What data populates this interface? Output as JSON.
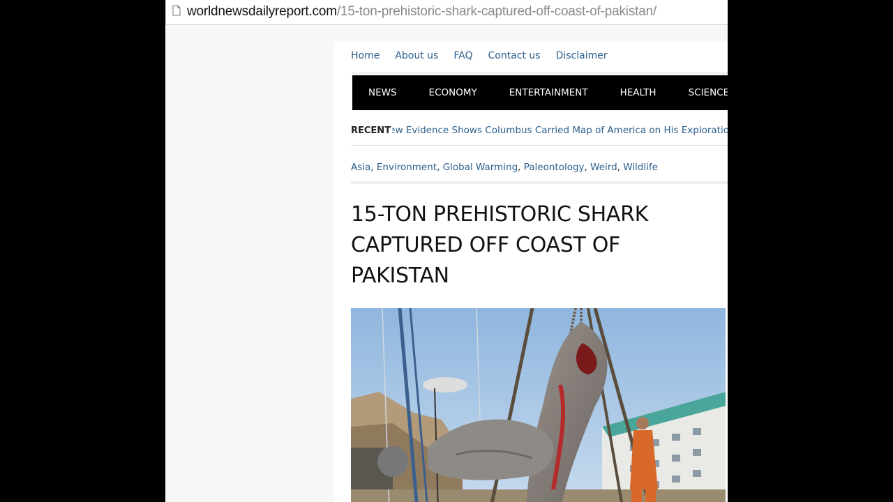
{
  "browser": {
    "url_domain": "worldnewsdailyreport.com",
    "url_path": "/15-ton-prehistoric-shark-captured-off-coast-of-pakistan/"
  },
  "top_nav": {
    "items": [
      {
        "label": "Home"
      },
      {
        "label": "About us"
      },
      {
        "label": "FAQ"
      },
      {
        "label": "Contact us"
      },
      {
        "label": "Disclaimer"
      }
    ]
  },
  "category_nav": {
    "items": [
      {
        "label": "NEWS"
      },
      {
        "label": "ECONOMY"
      },
      {
        "label": "ENTERTAINMENT"
      },
      {
        "label": "HEALTH"
      },
      {
        "label": "SCIENCE"
      }
    ]
  },
  "recent": {
    "label": "RECENT",
    "headline": "New Evidence Shows Columbus Carried Map of America on His Exploration"
  },
  "tags": [
    "Asia",
    "Environment",
    "Global Warming",
    "Paleontology",
    "Weird",
    "Wildlife"
  ],
  "tag_separator": ",",
  "article": {
    "title_lines": [
      "15-TON PREHISTORIC SHARK",
      "CAPTURED OFF COAST OF",
      "PAKISTAN"
    ]
  },
  "colors": {
    "link": "#2b5f8c",
    "nav_background": "#000000",
    "page_background": "#f7f7f7"
  },
  "icons": {
    "page": "page-icon"
  }
}
